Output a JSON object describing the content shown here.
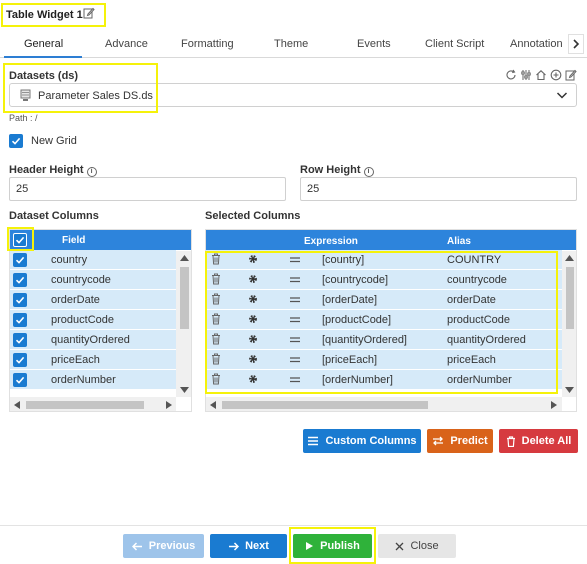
{
  "title": "Table Widget 1",
  "tabs": [
    "General",
    "Advance",
    "Formatting",
    "Theme",
    "Events",
    "Client Script",
    "Annotation"
  ],
  "datasets": {
    "label": "Datasets (ds)",
    "selected": "Parameter Sales DS.ds",
    "path": "Path : /"
  },
  "new_grid": {
    "label": "New Grid",
    "checked": true
  },
  "header_height": {
    "label": "Header Height",
    "value": "25"
  },
  "row_height": {
    "label": "Row Height",
    "value": "25"
  },
  "dataset_columns": {
    "label": "Dataset Columns",
    "header": "Field",
    "rows": [
      "country",
      "countrycode",
      "orderDate",
      "productCode",
      "quantityOrdered",
      "priceEach",
      "orderNumber"
    ]
  },
  "selected_columns": {
    "label": "Selected Columns",
    "headers": {
      "expression": "Expression",
      "alias": "Alias"
    },
    "rows": [
      {
        "expression": "[country]",
        "alias": "COUNTRY"
      },
      {
        "expression": "[countrycode]",
        "alias": "countrycode"
      },
      {
        "expression": "[orderDate]",
        "alias": "orderDate"
      },
      {
        "expression": "[productCode]",
        "alias": "productCode"
      },
      {
        "expression": "[quantityOrdered]",
        "alias": "quantityOrdered"
      },
      {
        "expression": "[priceEach]",
        "alias": "priceEach"
      },
      {
        "expression": "[orderNumber]",
        "alias": "orderNumber"
      }
    ]
  },
  "actions": {
    "custom_columns": "Custom Columns",
    "predict": "Predict",
    "delete_all": "Delete All"
  },
  "footer": {
    "previous": "Previous",
    "next": "Next",
    "publish": "Publish",
    "close": "Close"
  },
  "colors": {
    "primary": "#1a7bd1",
    "grid_header": "#2d84dc",
    "row_bg": "#d6eaf9",
    "predict": "#d9631a",
    "delete": "#d63a3f",
    "publish": "#2fb23a",
    "highlight": "#f5f20a"
  }
}
